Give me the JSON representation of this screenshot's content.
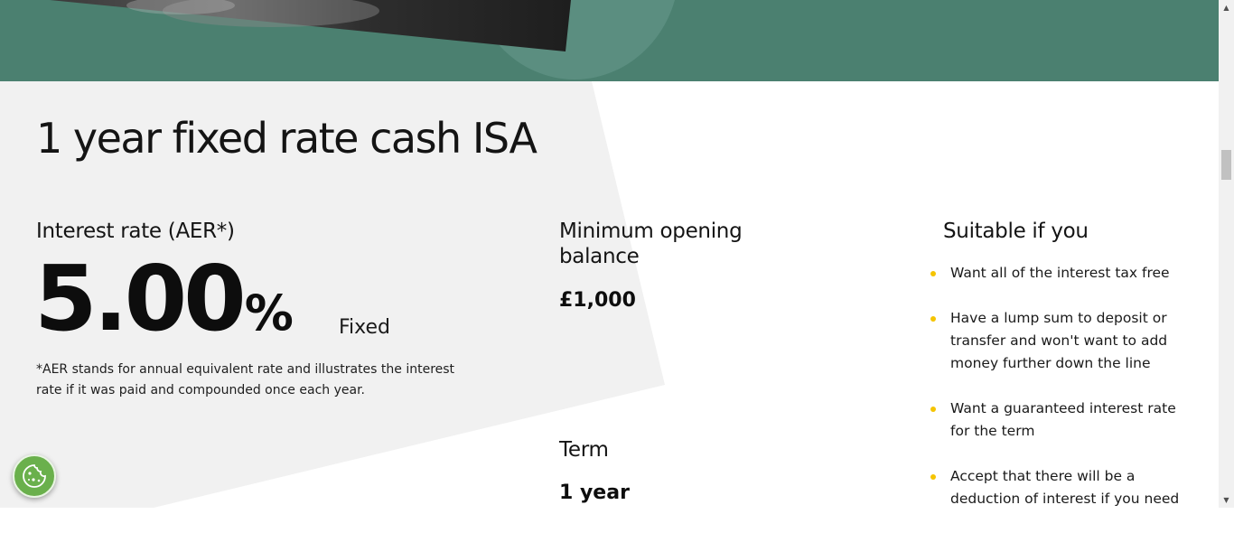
{
  "page": {
    "title": "1 year fixed rate cash ISA"
  },
  "interest": {
    "label": "Interest rate (AER*)",
    "rate_value": "5.00",
    "rate_symbol": "%",
    "rate_type": "Fixed",
    "aer_note": "*AER stands for annual equivalent rate and illustrates the interest rate if it was paid and compounded once each year."
  },
  "minimum_balance": {
    "label": "Minimum opening balance",
    "value": "£1,000"
  },
  "term": {
    "label": "Term",
    "value": "1 year"
  },
  "suitable": {
    "heading": "Suitable if you",
    "items": [
      "Want all of the interest tax free",
      "Have a lump sum to deposit or transfer and won't want to add money further down the line",
      "Want a guaranteed interest rate for the term",
      "Accept that there will be a deduction of interest if you need"
    ]
  },
  "cookie_button": {
    "icon": "cookie-icon"
  },
  "colors": {
    "hero_green": "#4b8070",
    "panel_grey": "#f1f1f1",
    "bullet_yellow": "#f5c400",
    "cookie_green": "#6ab04c"
  }
}
